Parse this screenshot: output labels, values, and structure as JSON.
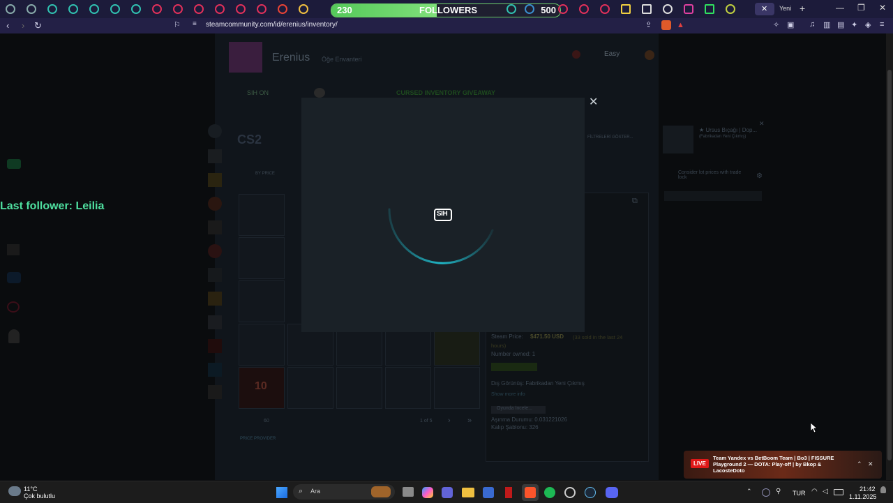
{
  "browser": {
    "new_tab_label": "Yeni",
    "url": "steamcommunity.com/id/erenius/inventory/",
    "follower_widget": {
      "current": "230",
      "label": "FOLLOWERS",
      "goal": "500",
      "progress": 0.46
    },
    "last_follower": "Last follower: Leilia"
  },
  "steam": {
    "profile_name": "Erenius",
    "profile_sub": "Öğe Envanteri",
    "level_label": "Easy",
    "sih_label": "SIH ON",
    "giveaway_label": "CURSED INVENTORY GIVEAWAY",
    "game_title": "CS2",
    "sort_label": "BY PRICE",
    "filters_label": "FİLTRELERİ GÖSTER...",
    "item_title": "★ Ursus Bıçağı | Dop...",
    "item_sub": "(Fabrikadan Yeni Çıkmış)",
    "compare_label": "Consider lot prices with trade lock",
    "steam_price_label": "Steam Price:",
    "steam_price_value": "$471.50 USD",
    "steam_price_note": "(33 sold in the last 24 hours)",
    "number_owned": "Number owned: 1",
    "wear_label": "Dış Görünüş: Fabrikadan Yeni Çıkmış",
    "show_more": "Show more info",
    "inspect_label": "Oyunda İncele...",
    "float_label": "Aşınma Durumu: 0.031221026",
    "pattern_label": "Kalıp Şablonu: 326",
    "price_provider": "PRICE PROVIDER",
    "pager": "1 of 5",
    "sticker_count": "10"
  },
  "modal": {
    "logo_text": "SIH",
    "close_icon": "close-icon"
  },
  "notification": {
    "live_badge": "LIVE",
    "text": "Team Yandex vs BetBoom Team | Bo3 | FISSURE Playground 2 — DOTA: Play-off | by Bkop & LacosteDoto"
  },
  "taskbar": {
    "weather_temp": "11°C",
    "weather_desc": "Çok bulutlu",
    "search_label": "Ara",
    "lang": "TUR",
    "time": "21:42",
    "date": "1.11.2025"
  },
  "colors": {
    "accent_green": "#55c95a",
    "spinner_cyan": "#1fb8c8",
    "follower_text": "#4fe0a0",
    "live_red": "#e01818"
  }
}
